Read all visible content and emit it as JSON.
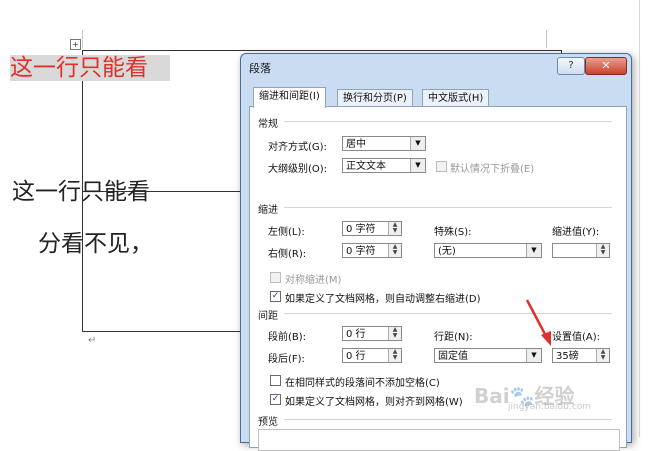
{
  "document": {
    "row1_text": "这一行只能看",
    "row2_line1": "这一行只能看",
    "row2_line2": "分看不见，",
    "paragraph_mark": "↵",
    "table_handle": "+"
  },
  "dialog": {
    "title": "段落",
    "help_label": "?",
    "close_label": "✕",
    "tabs": [
      {
        "label": "缩进和间距(I)",
        "active": true
      },
      {
        "label": "换行和分页(P)",
        "active": false
      },
      {
        "label": "中文版式(H)",
        "active": false
      }
    ],
    "general": {
      "group_label": "常规",
      "alignment_label": "对齐方式(G):",
      "alignment_value": "居中",
      "outline_label": "大纲级别(O):",
      "outline_value": "正文文本",
      "collapse_label": "默认情况下折叠(E)"
    },
    "indent": {
      "group_label": "缩进",
      "left_label": "左侧(L):",
      "left_value": "0 字符",
      "right_label": "右侧(R):",
      "right_value": "0 字符",
      "special_label": "特殊(S):",
      "special_value": "(无)",
      "indent_value_label": "缩进值(Y):",
      "indent_value": "",
      "mirror_label": "对称缩进(M)",
      "auto_adjust_label": "如果定义了文档网格，则自动调整右缩进(D)"
    },
    "spacing": {
      "group_label": "间距",
      "before_label": "段前(B):",
      "before_value": "0 行",
      "after_label": "段后(F):",
      "after_value": "0 行",
      "line_spacing_label": "行距(N):",
      "line_spacing_value": "固定值",
      "setting_label": "设置值(A):",
      "setting_value": "35磅",
      "no_space_label": "在相同样式的段落间不添加空格(C)",
      "snap_grid_label": "如果定义了文档网格，则对齐到网格(W)"
    },
    "preview": {
      "group_label": "预览"
    }
  },
  "watermark": {
    "text": "Bai🐾经验",
    "sub": "jingyan.baidu.com"
  },
  "colors": {
    "annotation_arrow": "#e0302c",
    "red_text": "#e0302c"
  }
}
